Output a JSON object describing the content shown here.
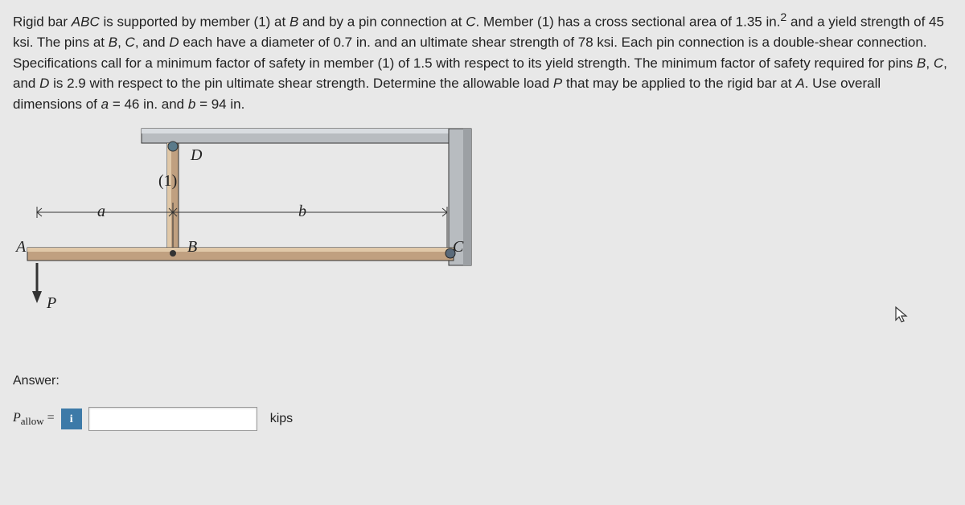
{
  "problem": {
    "text_part1": "Rigid bar ",
    "abc": "ABC",
    "text_part2": " is supported by member (1) at ",
    "B1": "B",
    "text_part3": " and by a pin connection at ",
    "C1": "C",
    "text_part4": ". Member (1) has a cross sectional area of 1.35 in.",
    "sq": "2",
    "text_part5": " and a yield strength of 45 ksi. The pins at ",
    "B2": "B",
    "comma1": ", ",
    "C2": "C",
    "text_part6": ", and ",
    "D1": "D",
    "text_part7": " each have a diameter of 0.7 in. and an ultimate shear strength of 78 ksi. Each pin connection is a double-shear connection. Specifications call for a minimum factor of safety in member (1) of 1.5 with respect to its yield strength. The minimum factor of safety required for pins ",
    "B3": "B",
    "comma2": ", ",
    "C3": "C",
    "text_part8": ", and ",
    "D2": "D",
    "text_part9": " is 2.9 with respect to the pin ultimate shear strength. Determine the allowable load ",
    "P1": "P",
    "text_part10": " that may be applied to the rigid bar at ",
    "A1": "A",
    "text_part11": ".  Use overall dimensions of ",
    "a_var": "a",
    "text_part12": " = 46 in. and ",
    "b_var": "b",
    "text_part13": " = 94 in."
  },
  "diagram": {
    "D": "D",
    "one": "(1)",
    "a": "a",
    "b": "b",
    "A": "A",
    "B": "B",
    "C": "C",
    "P": "P"
  },
  "answer": {
    "heading": "Answer:",
    "pallow_p": "P",
    "pallow_sub": "allow",
    "equals": " = ",
    "info": "i",
    "unit": "kips",
    "value": ""
  }
}
